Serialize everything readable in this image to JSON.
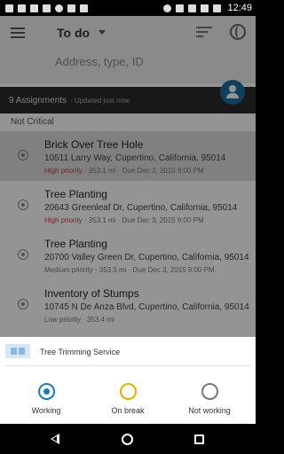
{
  "status_bar": {
    "time": "12:49"
  },
  "toolbar": {
    "title": "To do",
    "search_placeholder": "Address, type, ID"
  },
  "assignments": {
    "count_text": "9 Assignments",
    "updated_text": "· Updated just now"
  },
  "section_header": "Not Critical",
  "items": [
    {
      "title": "Brick Over Tree Hole",
      "address": "10511 Larry Way, Cupertino, California, 95014",
      "priority": "High priority",
      "meta": " · 353.1 mi · Due Dec 3, 2015 9:00 PM",
      "selected": true
    },
    {
      "title": "Tree Planting",
      "address": "20643 Greenleaf Dr, Cupertino, California, 95014",
      "priority": "High priority",
      "meta": " · 353.1 mi · Due Dec 3, 2015 9:00 PM",
      "selected": false
    },
    {
      "title": "Tree Planting",
      "address": "20700 Valley Green Dr, Cupertino, California, 95014",
      "priority": "Medium priority",
      "meta": " · 353.5 mi · Due Dec 3, 2015 9:00 PM",
      "selected": false
    },
    {
      "title": "Inventory of Stumps",
      "address": "10745 N De Anza Blvd, Cupertino, California, 95014",
      "priority": "Low priority",
      "meta": " · 353.4 mi",
      "selected": false
    }
  ],
  "sheet": {
    "title": "Tree Trimming Service",
    "options": [
      {
        "label": "Working",
        "state": "selected",
        "color": "#1a7ac2"
      },
      {
        "label": "On break",
        "state": "unselected",
        "color": "#e0b100"
      },
      {
        "label": "Not working",
        "state": "unselected",
        "color": "#777777"
      }
    ]
  }
}
